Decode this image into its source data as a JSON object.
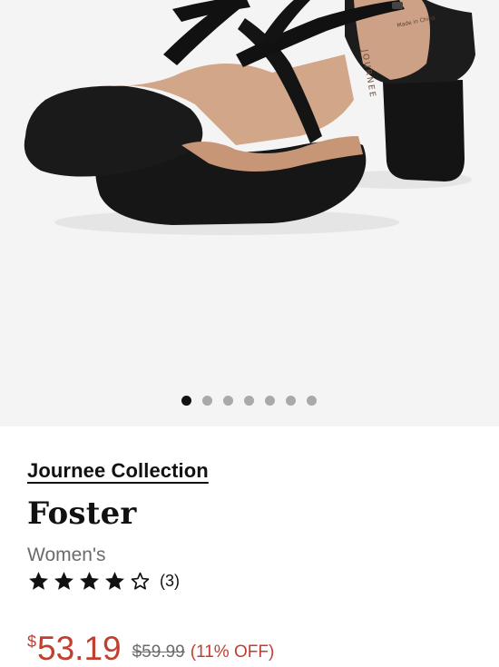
{
  "product_image": {
    "alt": "Journee Collection Foster black suede block heel pumps",
    "carousel_total": 7,
    "carousel_active_index": 0
  },
  "brand": "Journee Collection",
  "product_name": "Foster",
  "gender": "Women's",
  "rating": {
    "value": 4,
    "max": 5,
    "count_label": "(3)"
  },
  "price": {
    "currency_symbol": "$",
    "current": "53.19",
    "original": "$59.99",
    "discount": "(11% OFF)"
  },
  "colors": {
    "sale_red": "#c13f2e",
    "muted_gray": "#6b6b6b",
    "dot_active": "#111111",
    "dot_inactive": "#a9a9a9",
    "image_bg": "#f4f4f4"
  }
}
